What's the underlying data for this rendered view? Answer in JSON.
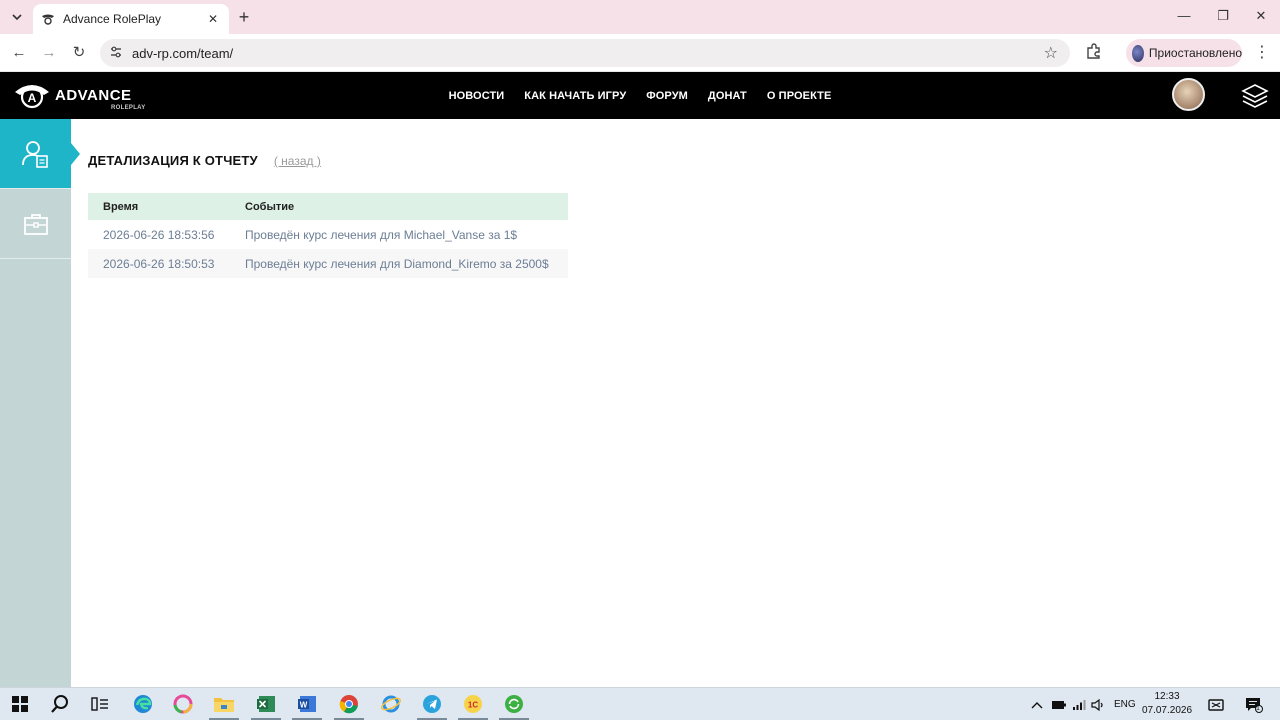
{
  "browser": {
    "tab_title": "Advance RolePlay",
    "url": "adv-rp.com/team/",
    "profile_label": "Приостановлено",
    "window_controls": {
      "minimize": "—",
      "maximize": "❐",
      "close": "✕"
    }
  },
  "site": {
    "logo_text": "ADVANCE",
    "logo_sub": "ROLEPLAY",
    "nav": [
      "НОВОСТИ",
      "КАК НАЧАТЬ ИГРУ",
      "ФОРУМ",
      "ДОНАТ",
      "О ПРОЕКТЕ"
    ]
  },
  "sidebar": {
    "items": [
      {
        "icon": "user-report-icon",
        "active": true
      },
      {
        "icon": "briefcase-icon",
        "active": false
      }
    ]
  },
  "page": {
    "heading": "ДЕТАЛИЗАЦИЯ К ОТЧЕТУ",
    "back_link": "( назад )",
    "table": {
      "headers": [
        "Время",
        "Событие"
      ],
      "rows": [
        {
          "time": "2026-06-26 18:53:56",
          "event": "Проведён курс лечения для Michael_Vanse за 1$"
        },
        {
          "time": "2026-06-26 18:50:53",
          "event": "Проведён курс лечения для Diamond_Kiremo за 2500$"
        }
      ]
    }
  },
  "taskbar": {
    "tray_language": "ENG",
    "time": "12:33",
    "date": "07.07.2026",
    "notification_count": "1"
  }
}
